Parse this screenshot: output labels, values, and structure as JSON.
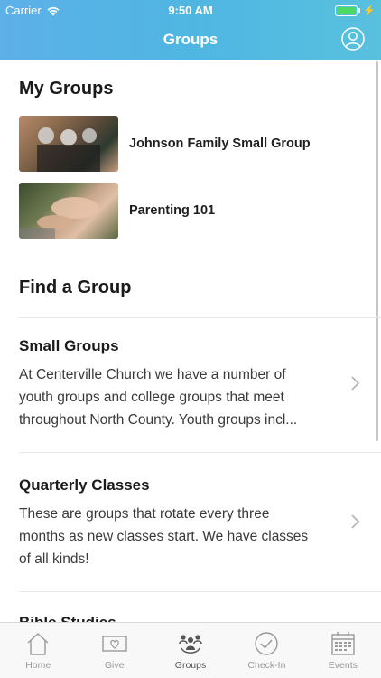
{
  "status_bar": {
    "carrier": "Carrier",
    "time": "9:50 AM"
  },
  "header": {
    "title": "Groups"
  },
  "my_groups": {
    "title": "My Groups",
    "items": [
      {
        "name": "Johnson Family Small Group"
      },
      {
        "name": "Parenting 101"
      }
    ]
  },
  "find_group": {
    "title": "Find a Group",
    "categories": [
      {
        "title": "Small Groups",
        "desc_lines": [
          "At Centerville Church we have a number of",
          "youth groups and college groups that meet",
          "throughout North County. Youth groups  incl..."
        ]
      },
      {
        "title": "Quarterly Classes",
        "desc_lines": [
          "These are groups that rotate every three",
          "months as new classes start. We have classes",
          "of all kinds!"
        ]
      },
      {
        "title": "Bible Studies"
      }
    ]
  },
  "tabs": [
    {
      "label": "Home",
      "icon": "home-icon"
    },
    {
      "label": "Give",
      "icon": "give-icon"
    },
    {
      "label": "Groups",
      "icon": "groups-icon",
      "active": true
    },
    {
      "label": "Check-In",
      "icon": "check-in-icon"
    },
    {
      "label": "Events",
      "icon": "calendar-icon"
    }
  ],
  "colors": {
    "header_start": "#5db0e8",
    "header_end": "#58c1de",
    "battery": "#4cd964"
  }
}
